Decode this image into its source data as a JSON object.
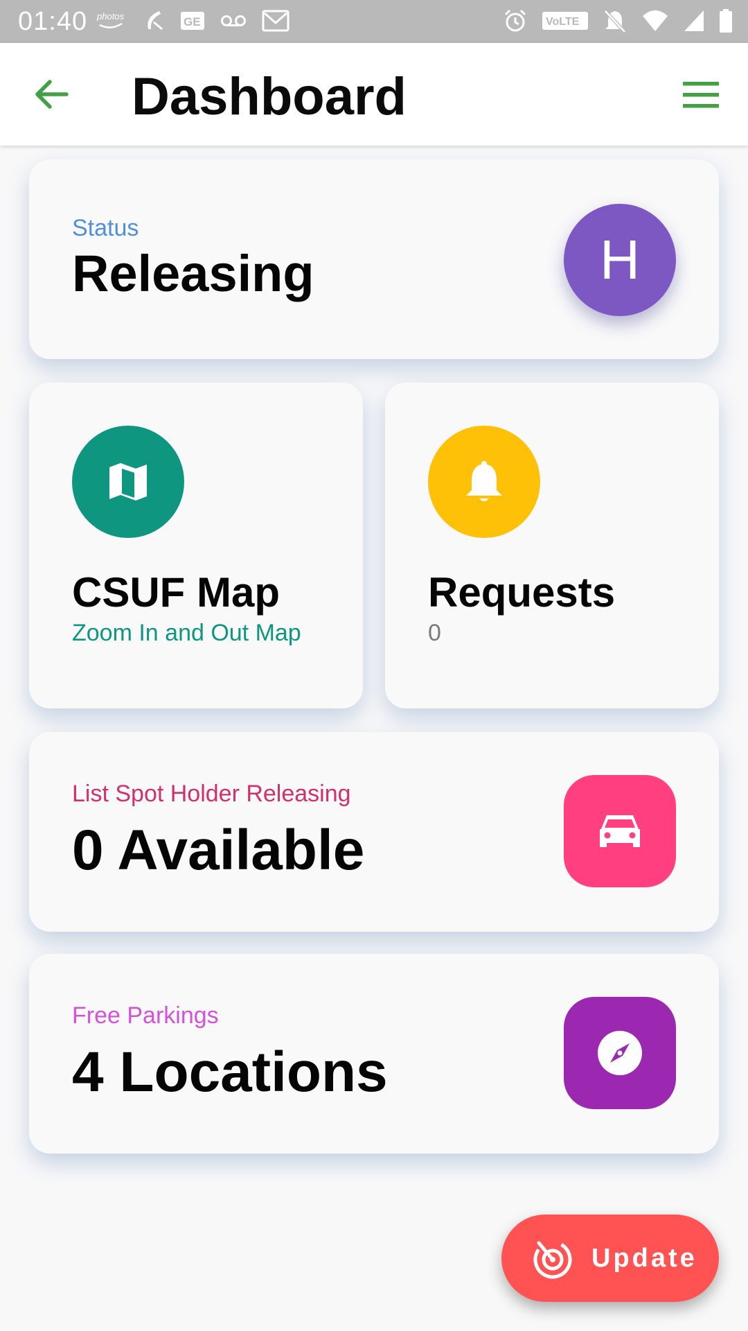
{
  "status_bar": {
    "time": "01:40",
    "left_icons": [
      "amazon-photos-icon",
      "app-icon",
      "ge-icon",
      "voicemail-icon",
      "gmail-icon"
    ],
    "right_icons": [
      "alarm-icon",
      "volte-icon",
      "mute-icon",
      "wifi-icon",
      "signal-icon",
      "battery-icon"
    ],
    "volte_text": "VoLTE"
  },
  "app_bar": {
    "title": "Dashboard",
    "back_icon": "arrow-back-icon",
    "menu_icon": "hamburger-menu-icon",
    "accent": "#43a047"
  },
  "status_card": {
    "label": "Status",
    "value": "Releasing",
    "avatar_letter": "H",
    "label_color": "#4f8fdc",
    "avatar_color": "#7e58c2"
  },
  "map_tile": {
    "icon": "map-icon",
    "title": "CSUF Map",
    "subtitle": "Zoom In and Out Map",
    "color": "#0f9681"
  },
  "requests_tile": {
    "icon": "bell-icon",
    "title": "Requests",
    "subtitle": "0",
    "color": "#ffc107"
  },
  "spot_card": {
    "label": "List Spot Holder Releasing",
    "value": "0 Available",
    "icon": "car-icon",
    "color": "#ff3f7f"
  },
  "free_card": {
    "label": "Free Parkings",
    "value": "4 Locations",
    "icon": "compass-icon",
    "color": "#9c27b0"
  },
  "fab": {
    "label": "Update",
    "icon": "radar-icon",
    "color": "#ff5252"
  }
}
